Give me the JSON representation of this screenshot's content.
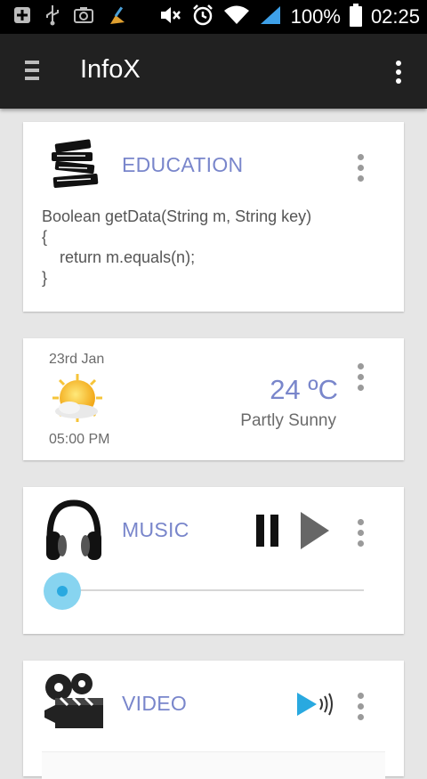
{
  "status_bar": {
    "battery_percent": "100%",
    "time": "02:25",
    "left_icons": [
      "add-icon",
      "usb-icon",
      "camera-icon",
      "cleaner-icon"
    ],
    "right_icons": [
      "mute-icon",
      "alarm-icon",
      "wifi-icon",
      "signal-icon",
      "battery-icon"
    ]
  },
  "app_bar": {
    "title": "InfoX",
    "menu_icon": "hamburger-icon",
    "overflow_icon": "more-vertical-icon"
  },
  "cards": {
    "education": {
      "title": "EDUCATION",
      "icon": "books-icon",
      "code": "Boolean getData(String m, String key)\n{\n    return m.equals(n);\n}"
    },
    "weather": {
      "date": "23rd Jan",
      "time": "05:00 PM",
      "temperature": "24 ºC",
      "condition": "Partly Sunny",
      "icon": "partly-sunny-icon"
    },
    "music": {
      "title": "MUSIC",
      "icon": "headphones-icon",
      "progress": 0.0
    },
    "video": {
      "title": "VIDEO",
      "icon": "clapperboard-icon"
    }
  },
  "colors": {
    "accent": "#7986cb",
    "app_bar": "#212121",
    "background": "#e6e6e6",
    "slider": "#29a9e0",
    "video_play": "#29a9e0"
  }
}
